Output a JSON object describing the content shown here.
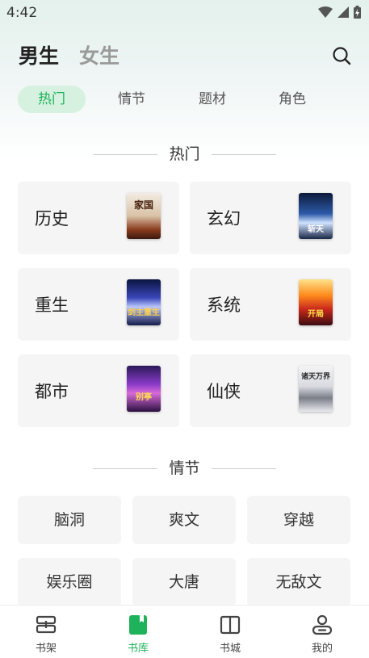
{
  "status": {
    "time": "4:42"
  },
  "header": {
    "tabs": [
      {
        "label": "男生",
        "active": true
      },
      {
        "label": "女生",
        "active": false
      }
    ],
    "search_icon": "search-icon"
  },
  "subtabs": [
    {
      "label": "热门",
      "active": true
    },
    {
      "label": "情节",
      "active": false
    },
    {
      "label": "题材",
      "active": false
    },
    {
      "label": "角色",
      "active": false
    }
  ],
  "hot": {
    "title": "热门",
    "categories": [
      {
        "label": "历史",
        "cover_text": "家国"
      },
      {
        "label": "玄幻",
        "cover_text": "斩天"
      },
      {
        "label": "重生",
        "cover_text": "剑主重生"
      },
      {
        "label": "系统",
        "cover_text": "开局"
      },
      {
        "label": "都市",
        "cover_text": "别亭"
      },
      {
        "label": "仙侠",
        "cover_text": "诸天万界"
      }
    ]
  },
  "plot": {
    "title": "情节",
    "tags": [
      "脑洞",
      "爽文",
      "穿越",
      "娱乐圈",
      "大唐",
      "无敌文"
    ]
  },
  "nav": {
    "items": [
      {
        "label": "书架",
        "icon": "bookshelf-icon",
        "active": false
      },
      {
        "label": "书库",
        "icon": "library-icon",
        "active": true
      },
      {
        "label": "书城",
        "icon": "bookstore-icon",
        "active": false
      },
      {
        "label": "我的",
        "icon": "profile-icon",
        "active": false
      }
    ]
  },
  "colors": {
    "accent": "#1eb25a",
    "accent_bg": "#d7f1e0",
    "card_bg": "#f5f5f5"
  }
}
